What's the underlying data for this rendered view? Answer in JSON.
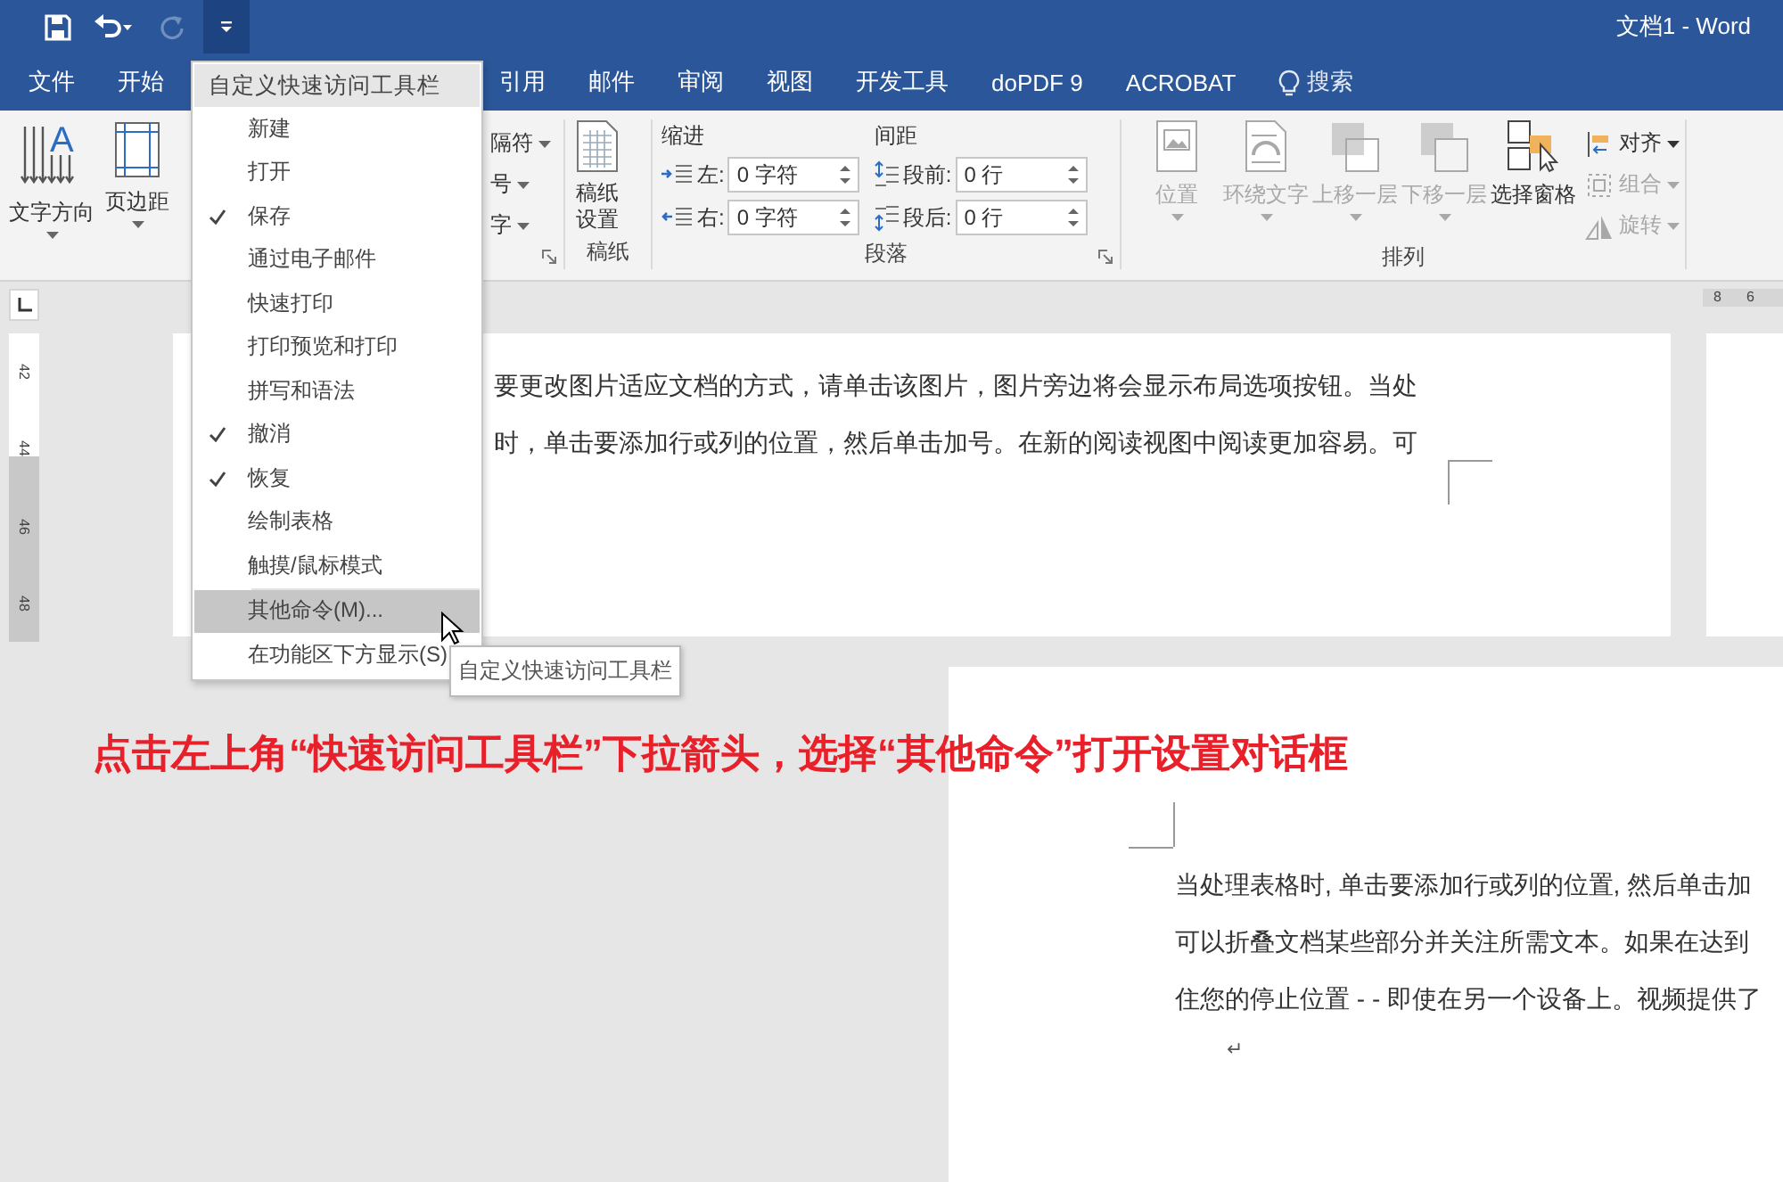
{
  "window": {
    "title": "文档1  -  Word"
  },
  "quick_access": [
    {
      "kind": "save",
      "disabled": false
    },
    {
      "kind": "undo",
      "disabled": false
    },
    {
      "kind": "redo",
      "disabled": true
    },
    {
      "kind": "customize",
      "pressed": true
    }
  ],
  "tabs": [
    {
      "label": "文件"
    },
    {
      "label": "开始"
    },
    {
      "label": "引用"
    },
    {
      "label": "邮件"
    },
    {
      "label": "审阅"
    },
    {
      "label": "视图"
    },
    {
      "label": "开发工具"
    },
    {
      "label": "doPDF 9"
    },
    {
      "label": "ACROBAT"
    }
  ],
  "search": {
    "label": "搜索"
  },
  "ribbon": {
    "page_setup": {
      "buttons": [
        {
          "kind": "text-direction",
          "label": "文字方向",
          "icon_letter": "A"
        },
        {
          "kind": "margins",
          "label": "页边距"
        }
      ],
      "items": [
        "隔符",
        "号",
        "字"
      ]
    },
    "manuscript": {
      "button": "稿纸设置",
      "label": "稿纸"
    },
    "paragraph": {
      "label": "段落",
      "indent": {
        "title": "缩进",
        "fields": [
          {
            "kind": "left",
            "label": "左:",
            "value": "0 字符"
          },
          {
            "kind": "right",
            "label": "右:",
            "value": "0 字符"
          }
        ]
      },
      "spacing": {
        "title": "间距",
        "fields": [
          {
            "kind": "before",
            "label": "段前:",
            "value": "0 行"
          },
          {
            "kind": "after",
            "label": "段后:",
            "value": "0 行"
          }
        ]
      }
    },
    "arrange": {
      "label": "排列",
      "large": [
        {
          "kind": "position",
          "label": "位置",
          "disabled": true,
          "dropdown": true
        },
        {
          "kind": "wrap",
          "label": "环绕文字",
          "disabled": true,
          "dropdown": true
        },
        {
          "kind": "forward",
          "label": "上移一层",
          "disabled": true,
          "dropdown": true
        },
        {
          "kind": "backward",
          "label": "下移一层",
          "disabled": true,
          "dropdown": true
        },
        {
          "kind": "pane",
          "label": "选择窗格",
          "disabled": false,
          "dropdown": false
        }
      ],
      "small": [
        {
          "kind": "align",
          "label": "对齐",
          "disabled": false
        },
        {
          "kind": "group",
          "label": "组合",
          "disabled": true
        },
        {
          "kind": "rotate",
          "label": "旋转",
          "disabled": true
        }
      ]
    }
  },
  "ruler": {
    "vertical": [
      "42",
      "44",
      "46",
      "48"
    ],
    "horizontal": [
      "8",
      "6"
    ]
  },
  "pages": [
    {
      "lines": [
        "要更改图片适应文档的方式，请单击该图片，图片旁边将会显示布局选项按钮。当处",
        "时，单击要添加行或列的位置，然后单击加号。在新的阅读视图中阅读更加容易。可"
      ]
    },
    {
      "lines": [
        "当处理表格时, 单击要添加行或列的位置, 然后单击加",
        "可以折叠文档某些部分并关注所需文本。如果在达到",
        "住您的停止位置 - - 即使在另一个设备上。视频提供了"
      ],
      "paragraph_mark": "↵"
    }
  ],
  "menu": {
    "title": "自定义快速访问工具栏",
    "items": [
      {
        "label": "新建",
        "checked": false
      },
      {
        "label": "打开",
        "checked": false
      },
      {
        "label": "保存",
        "checked": true
      },
      {
        "label": "通过电子邮件",
        "checked": false
      },
      {
        "label": "快速打印",
        "checked": false
      },
      {
        "label": "打印预览和打印",
        "checked": false
      },
      {
        "label": "拼写和语法",
        "checked": false
      },
      {
        "label": "撤消",
        "checked": true
      },
      {
        "label": "恢复",
        "checked": true
      },
      {
        "label": "绘制表格",
        "checked": false
      },
      {
        "label": "触摸/鼠标模式",
        "checked": false
      }
    ],
    "more": [
      {
        "label": "其他命令(M)...",
        "selected": true
      },
      {
        "label": "在功能区下方显示(S)",
        "selected": false
      }
    ]
  },
  "tooltip": {
    "text": "自定义快速访问工具栏"
  },
  "annotation": {
    "text": "点击左上角“快速访问工具栏”下拉箭头，选择“其他命令”打开设置对话框"
  }
}
